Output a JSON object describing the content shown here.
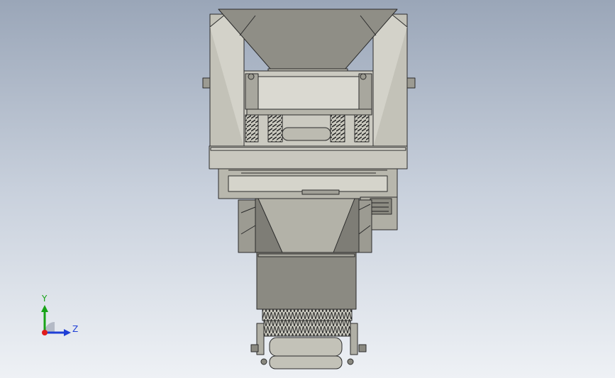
{
  "viewport": {
    "background_top": "#9aa6b8",
    "background_bottom": "#eef1f5"
  },
  "triad": {
    "y_label": "Y",
    "z_label": "Z",
    "y_color": "#17a317",
    "z_color": "#1f3fd6",
    "origin_color": "#e01b1b"
  },
  "model": {
    "icon": "cad-model-machine",
    "body_color": "#b9b8ae",
    "body_dark": "#85847c",
    "edge_color": "#2b2b2b"
  }
}
